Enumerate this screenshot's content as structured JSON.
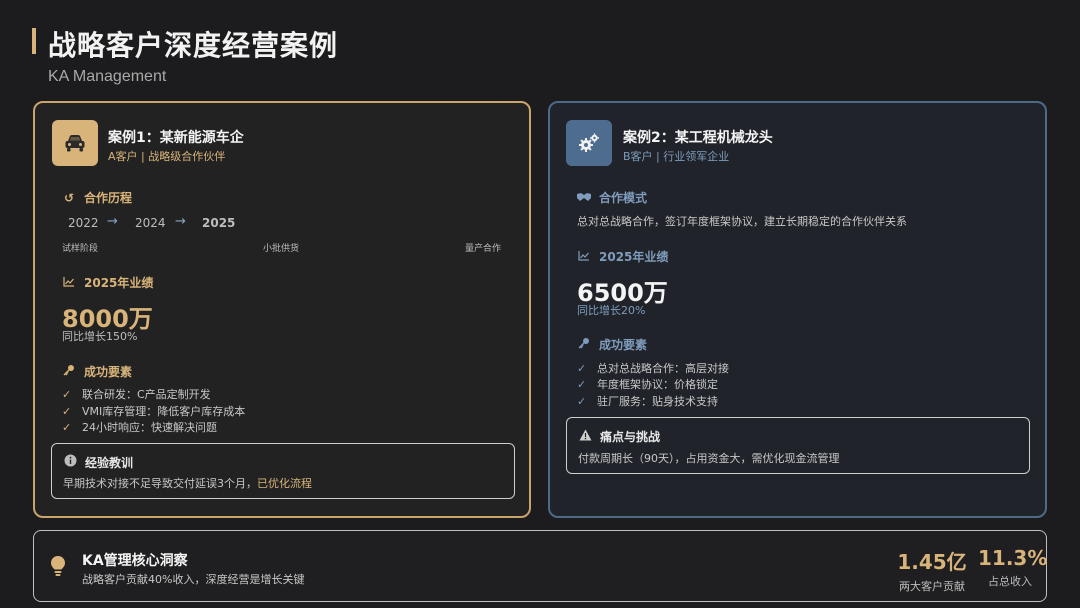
{
  "header": {
    "title": "战略客户深度经营案例",
    "subtitle": "KA Management"
  },
  "colors": {
    "gold": "#d8b47a",
    "blue": "#4e6d8e",
    "background": "#1c1c1e"
  },
  "case1": {
    "icon": "car-icon",
    "title": "案例1：某新能源车企",
    "subtitle": "A客户 | 战略级合作伙伴",
    "history": {
      "title": "合作历程",
      "years": [
        "2022",
        "2024",
        "2025"
      ],
      "stages": [
        "试样阶段",
        "小批供货",
        "量产合作"
      ]
    },
    "performance": {
      "title": "2025年业绩",
      "value": "8000万",
      "growth": "同比增长150%"
    },
    "factors": {
      "title": "成功要素",
      "items": [
        "联合研发：C产品定制开发",
        "VMI库存管理：降低客户库存成本",
        "24小时响应：快速解决问题"
      ]
    },
    "lesson": {
      "title": "经验教训",
      "text": "早期技术对接不足导致交付延误3个月，",
      "highlight": "已优化流程"
    }
  },
  "case2": {
    "icon": "gears-icon",
    "title": "案例2：某工程机械龙头",
    "subtitle": "B客户 | 行业领军企业",
    "mode": {
      "title": "合作模式",
      "text": "总对总战略合作，签订年度框架协议，建立长期稳定的合作伙伴关系"
    },
    "performance": {
      "title": "2025年业绩",
      "value": "6500万",
      "growth": "同比增长20%"
    },
    "factors": {
      "title": "成功要素",
      "items": [
        "总对总战略合作：高层对接",
        "年度框架协议：价格锁定",
        "驻厂服务：贴身技术支持"
      ]
    },
    "challenge": {
      "title": "痛点与挑战",
      "text": "付款周期长（90天），占用资金大，需优化现金流管理"
    }
  },
  "insight": {
    "title": "KA管理核心洞察",
    "text": "战略客户贡献40%收入，深度经营是增长关键",
    "stats": [
      {
        "value": "1.45亿",
        "label": "两大客户贡献"
      },
      {
        "value": "11.3%",
        "label": "占总收入"
      }
    ]
  }
}
